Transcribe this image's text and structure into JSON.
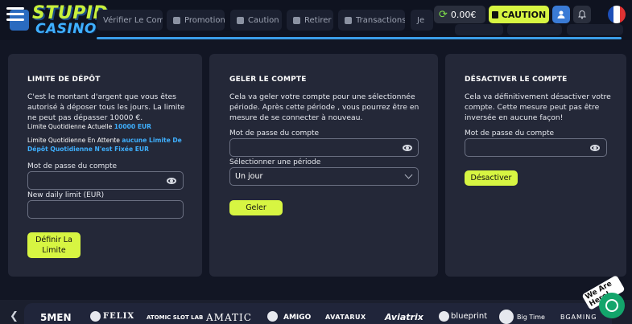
{
  "header": {
    "logo_top": "STUPID",
    "logo_bottom": "CASINO",
    "tabs": [
      {
        "label": "Vérifier Le Compte"
      },
      {
        "label": "Promotion"
      },
      {
        "label": "Caution"
      },
      {
        "label": "Retirer"
      },
      {
        "label": "Transactions"
      },
      {
        "label": "Je"
      }
    ],
    "balance": "0.00€",
    "caution_label": "CAUTION"
  },
  "deposit_limit": {
    "title": "LIMITE DE DÉPÔT",
    "description": "C'est le montant d'argent que vous êtes autorisé à déposer tous les jours. La limite ne peut pas dépasser 10000 €.",
    "current_label": "Limite Quotidienne Actuelle",
    "current_value": "10000 EUR",
    "pending_label": "Limite Quotidienne En Attente",
    "pending_value": "aucune Limite De",
    "pending_value_line2": "Dépôt Quotidienne N'est Fixée EUR",
    "password_label": "Mot de passe du compte",
    "new_limit_label": "New daily limit (EUR)",
    "button_line1": "Définir La",
    "button_line2": "Limite"
  },
  "freeze": {
    "title": "GELER LE COMPTE",
    "description": "Cela va geler votre compte pour une sélectionnée période. Après cette période , vous pourrez être en mesure de se connecter à nouveau.",
    "password_label": "Mot de passe du compte",
    "period_label": "Sélectionner une période",
    "period_value": "Un jour",
    "button": "Geler"
  },
  "deactivate": {
    "title": "DÉSACTIVER LE COMPTE",
    "description": "Cela va définitivement désactiver votre compte. Cette mesure peut pas être inversée en aucune façon!",
    "password_label": "Mot de passe du compte",
    "button": "Désactiver"
  },
  "providers": [
    "5MEN",
    "FELIX",
    "ATOMIC SLOT LAB",
    "AMATIC",
    "AMIGO",
    "AVATARUX",
    "Aviatrix",
    "blueprint",
    "Big Time",
    "BGAMING"
  ],
  "chat": {
    "label": "We Are Here!"
  },
  "colors": {
    "accent": "#d7f542",
    "link": "#3fb0ff",
    "panel": "#242838",
    "background": "#121624"
  }
}
